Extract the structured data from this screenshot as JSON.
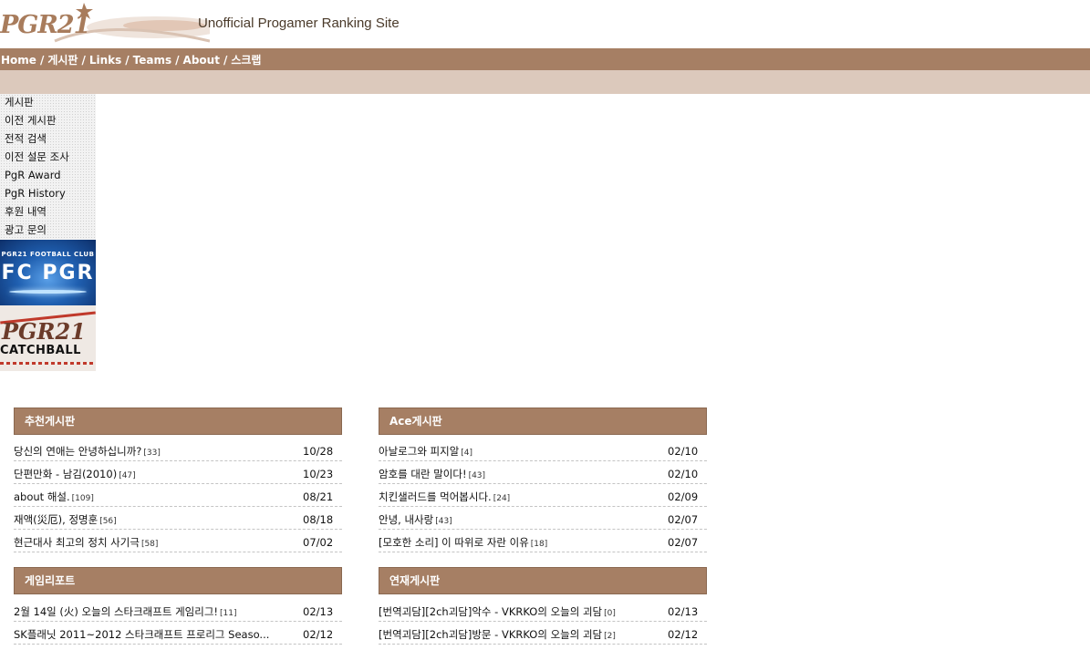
{
  "header": {
    "logo_text": "PGR21",
    "tagline": "Unofficial Progamer Ranking Site"
  },
  "nav": {
    "items": [
      "Home",
      "게시판",
      "Links",
      "Teams",
      "About",
      "스크랩"
    ],
    "separator": "/"
  },
  "sidebar": {
    "items": [
      "게시판",
      "이전 게시판",
      "전적 검색",
      "이전 설문 조사",
      "PgR Award",
      "PgR History",
      "후원 내역",
      "광고 문의"
    ],
    "banners": [
      {
        "small": "PGR21 FOOTBALL CLUB",
        "big": "FC PGR"
      },
      {
        "big": "PGR21",
        "small": "CATCHBALL"
      }
    ]
  },
  "boards": [
    {
      "title": "추천게시판",
      "posts": [
        {
          "title": "당신의 연애는 안녕하십니까?",
          "count": "[33]",
          "date": "10/28"
        },
        {
          "title": "단편만화 - 남김(2010)",
          "count": "[47]",
          "date": "10/23"
        },
        {
          "title": "about 해설.",
          "count": "[109]",
          "date": "08/21"
        },
        {
          "title": "재액(災厄), 정명훈",
          "count": "[56]",
          "date": "08/18"
        },
        {
          "title": "현근대사 최고의 정치 사기극",
          "count": "[58]",
          "date": "07/02"
        }
      ]
    },
    {
      "title": "Ace게시판",
      "posts": [
        {
          "title": "아날로그와 피지알",
          "count": "[4]",
          "date": "02/10"
        },
        {
          "title": "암호를 대란 말이다!",
          "count": "[43]",
          "date": "02/10"
        },
        {
          "title": "치킨샐러드를 먹어봅시다.",
          "count": "[24]",
          "date": "02/09"
        },
        {
          "title": "안녕, 내사랑",
          "count": "[43]",
          "date": "02/07"
        },
        {
          "title": "[모호한 소리] 이 따위로 자란 이유",
          "count": "[18]",
          "date": "02/07"
        }
      ]
    },
    {
      "title": "게임리포트",
      "posts": [
        {
          "title": "2월 14일 (火) 오늘의 스타크래프트 게임리그!",
          "count": "[11]",
          "date": "02/13"
        },
        {
          "title": "SK플래닛 2011~2012 스타크래프트 프로리그 Seaso...",
          "count": "",
          "date": "02/12"
        }
      ]
    },
    {
      "title": "연재게시판",
      "posts": [
        {
          "title": "[번역괴담][2ch괴담]악수 - VKRKO의 오늘의 괴담",
          "count": "[0]",
          "date": "02/13"
        },
        {
          "title": "[번역괴담][2ch괴담]방문 - VKRKO의 오늘의 괴담",
          "count": "[2]",
          "date": "02/12"
        }
      ]
    }
  ]
}
